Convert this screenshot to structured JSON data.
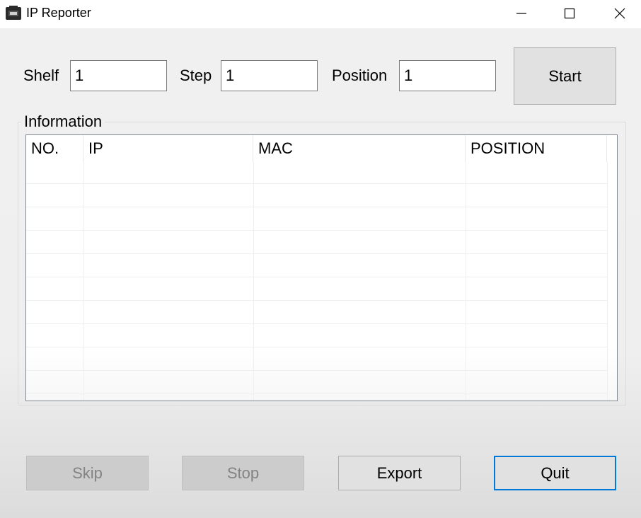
{
  "window": {
    "title": "IP Reporter"
  },
  "inputs": {
    "shelf": {
      "label": "Shelf",
      "value": "1"
    },
    "step": {
      "label": "Step",
      "value": "1"
    },
    "position": {
      "label": "Position",
      "value": "1"
    }
  },
  "buttons": {
    "start": "Start",
    "skip": "Skip",
    "stop": "Stop",
    "export": "Export",
    "quit": "Quit"
  },
  "info": {
    "title": "Information",
    "columns": [
      "NO.",
      "IP",
      "MAC",
      "POSITION"
    ],
    "rows": []
  },
  "icons": {
    "app": "app-icon",
    "minimize": "minimize-icon",
    "maximize": "maximize-icon",
    "close": "close-icon"
  },
  "colors": {
    "focus_border": "#0078d7",
    "disabled_text": "#838383",
    "button_face": "#e1e1e1"
  }
}
